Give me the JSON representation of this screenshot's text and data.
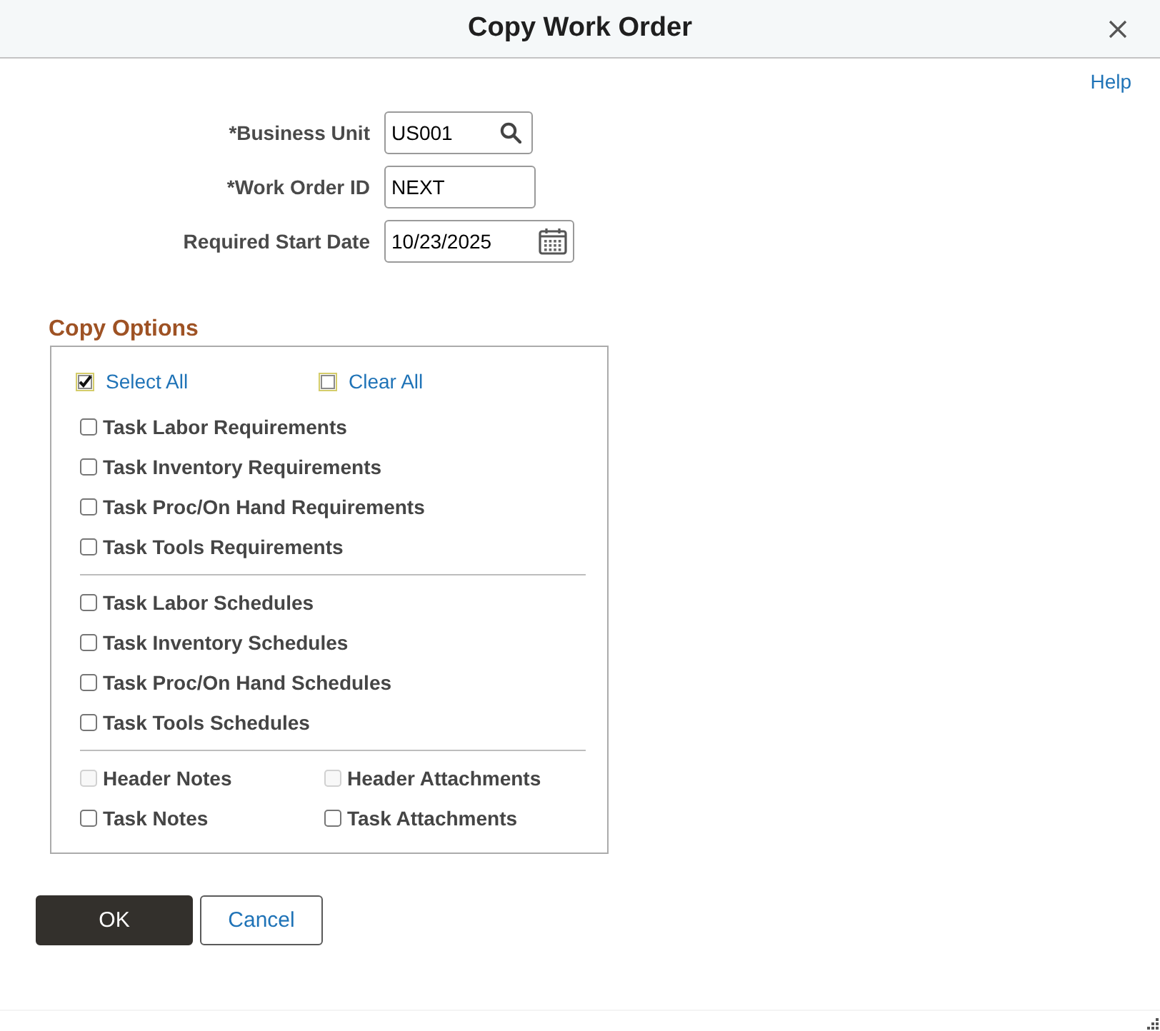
{
  "dialog": {
    "title": "Copy Work Order"
  },
  "help_link": "Help",
  "fields": [
    {
      "label": "*Business Unit",
      "value": "US001",
      "kind": "lookup"
    },
    {
      "label": "*Work Order ID",
      "value": "NEXT",
      "kind": "text"
    },
    {
      "label": "Required Start Date",
      "value": "10/23/2025",
      "kind": "date"
    }
  ],
  "copy_options": {
    "title": "Copy Options",
    "select_all": {
      "label": "Select All",
      "checked": true
    },
    "clear_all": {
      "label": "Clear All",
      "checked": false
    },
    "groups": [
      {
        "kind": "list",
        "options": [
          {
            "label": "Task Labor Requirements",
            "checked": false,
            "disabled": false
          },
          {
            "label": "Task Inventory Requirements",
            "checked": false,
            "disabled": false
          },
          {
            "label": "Task Proc/On Hand Requirements",
            "checked": false,
            "disabled": false
          },
          {
            "label": "Task Tools Requirements",
            "checked": false,
            "disabled": false
          }
        ]
      },
      {
        "kind": "list",
        "options": [
          {
            "label": "Task Labor Schedules",
            "checked": false,
            "disabled": false
          },
          {
            "label": "Task Inventory Schedules",
            "checked": false,
            "disabled": false
          },
          {
            "label": "Task Proc/On Hand Schedules",
            "checked": false,
            "disabled": false
          },
          {
            "label": "Task Tools Schedules",
            "checked": false,
            "disabled": false
          }
        ]
      },
      {
        "kind": "grid",
        "options": [
          {
            "label": "Header Notes",
            "checked": false,
            "disabled": true
          },
          {
            "label": "Header Attachments",
            "checked": false,
            "disabled": true
          },
          {
            "label": "Task Notes",
            "checked": false,
            "disabled": false
          },
          {
            "label": "Task Attachments",
            "checked": false,
            "disabled": false
          }
        ]
      }
    ]
  },
  "buttons": [
    {
      "label": "OK",
      "kind": "primary"
    },
    {
      "label": "Cancel",
      "kind": "secondary"
    }
  ]
}
